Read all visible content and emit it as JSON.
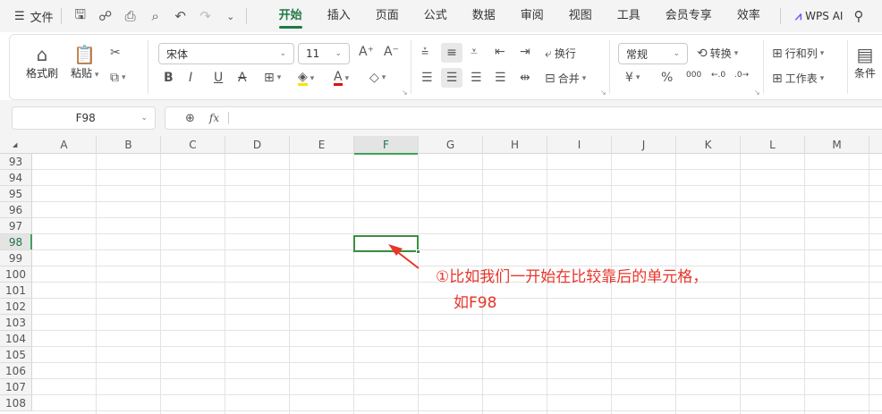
{
  "menubar": {
    "file_label": "文件",
    "tabs": [
      {
        "label": "开始",
        "active": true
      },
      {
        "label": "插入"
      },
      {
        "label": "页面"
      },
      {
        "label": "公式"
      },
      {
        "label": "数据"
      },
      {
        "label": "审阅"
      },
      {
        "label": "视图"
      },
      {
        "label": "工具"
      },
      {
        "label": "会员专享"
      },
      {
        "label": "效率"
      }
    ],
    "wps_ai_label": "WPS AI",
    "accent_color": "#1f7a45"
  },
  "ribbon": {
    "format_painter": "格式刷",
    "paste": "粘贴",
    "font_name": "宋体",
    "font_size": "11",
    "wrap": "换行",
    "merge": "合并",
    "number_format": "常规",
    "convert": "转换",
    "row_col": "行和列",
    "worksheet": "工作表",
    "conditional": "条件",
    "bold": "B",
    "italic": "I",
    "underline": "U",
    "strike": "A",
    "font_color_letter": "A",
    "currency": "¥",
    "percent": "%",
    "thousands": "000"
  },
  "formula_bar": {
    "name_box": "F98",
    "fx_label": "fx",
    "formula": ""
  },
  "sheet": {
    "columns": [
      "A",
      "B",
      "C",
      "D",
      "E",
      "F",
      "G",
      "H",
      "I",
      "J",
      "K",
      "L",
      "M"
    ],
    "selected_column": "F",
    "rows": [
      "93",
      "94",
      "95",
      "96",
      "97",
      "98",
      "99",
      "100",
      "101",
      "102",
      "103",
      "104",
      "105",
      "106",
      "107",
      "108"
    ],
    "selected_row": "98"
  },
  "annotation": {
    "line1": "①比如我们一开始在比较靠后的单元格，",
    "line2": "如F98",
    "color": "#e8352a"
  }
}
